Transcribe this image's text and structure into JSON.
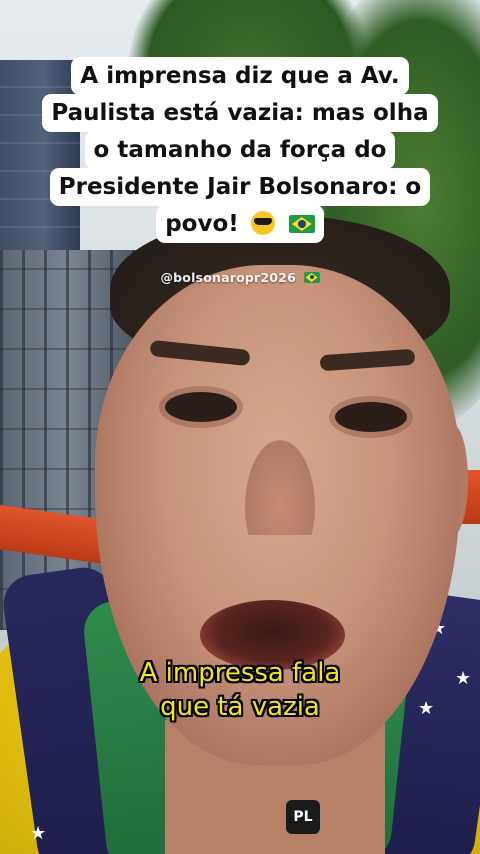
{
  "caption": {
    "lines": [
      "A imprensa diz que a Av.",
      "Paulista está vazia: mas olha",
      "o tamanho da força do",
      "Presidente Jair Bolsonaro: o",
      "povo!"
    ],
    "emojis": [
      "smiling-face-with-sunglasses-icon",
      "brazil-flag-icon"
    ]
  },
  "watermark": {
    "handle": "@bolsonaropr2026",
    "icon": "brazil-flag-icon"
  },
  "subtitle": {
    "lines": [
      "A impressa fala",
      "que tá vazia"
    ],
    "color": "#f4e61a"
  },
  "badge": {
    "text": "PL"
  },
  "colors": {
    "caption_bg": "#ffffff",
    "caption_text": "#111111",
    "shirt_yellow": "#f2d319",
    "flag_blue": "#27285c",
    "flag_green": "#2f8a4d",
    "railing_orange": "#e2552b"
  }
}
